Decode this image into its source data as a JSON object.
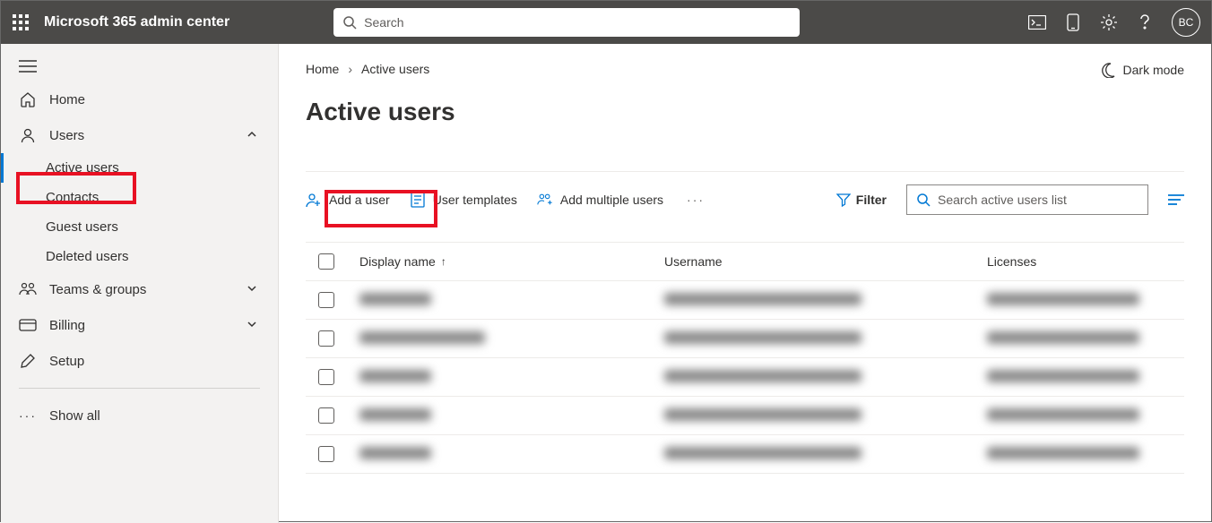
{
  "header": {
    "app_title": "Microsoft 365 admin center",
    "search_placeholder": "Search",
    "avatar_initials": "BC"
  },
  "sidebar": {
    "items": [
      {
        "icon": "home",
        "label": "Home"
      },
      {
        "icon": "user",
        "label": "Users",
        "expanded": true,
        "children": [
          {
            "label": "Active users",
            "active": true
          },
          {
            "label": "Contacts"
          },
          {
            "label": "Guest users"
          },
          {
            "label": "Deleted users"
          }
        ]
      },
      {
        "icon": "teams",
        "label": "Teams & groups",
        "chevron": true
      },
      {
        "icon": "billing",
        "label": "Billing",
        "chevron": true
      },
      {
        "icon": "setup",
        "label": "Setup"
      }
    ],
    "show_all": "Show all"
  },
  "breadcrumb": {
    "home": "Home",
    "current": "Active users"
  },
  "dark_mode_label": "Dark mode",
  "page_title": "Active users",
  "toolbar": {
    "add_user": "Add a user",
    "user_templates": "User templates",
    "add_multiple": "Add multiple users",
    "filter": "Filter",
    "search_placeholder": "Search active users list"
  },
  "table": {
    "columns": {
      "display_name": "Display name",
      "username": "Username",
      "licenses": "Licenses"
    },
    "rows": [
      {
        "name": "████",
        "username": "████████████",
        "licenses": "██████████"
      },
      {
        "name": "█████",
        "username": "████████████",
        "licenses": "██████████"
      },
      {
        "name": "████",
        "username": "████████████",
        "licenses": "██████████"
      },
      {
        "name": "████",
        "username": "████████████",
        "licenses": "██████████"
      },
      {
        "name": "████",
        "username": "████████████",
        "licenses": "██████████"
      }
    ]
  }
}
